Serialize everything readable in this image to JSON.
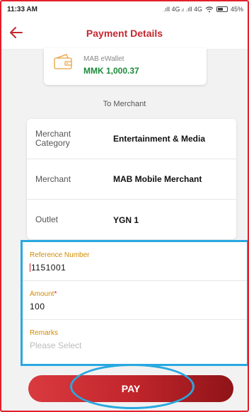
{
  "status_bar": {
    "time": "11:33 AM",
    "network": ".ıll 4G ᵢₗ .ıll 4G",
    "battery": "45%"
  },
  "header": {
    "title": "Payment Details",
    "back_icon": "arrow-left-icon"
  },
  "wallet": {
    "icon": "wallet-icon",
    "label": "MAB eWallet",
    "balance": "MMK 1,000.37"
  },
  "section_title": "To Merchant",
  "merchant_details": [
    {
      "key": "Merchant Category",
      "value": "Entertainment & Media"
    },
    {
      "key": "Merchant",
      "value": "MAB Mobile Merchant"
    },
    {
      "key": "Outlet",
      "value": "YGN 1"
    }
  ],
  "form": {
    "reference_label": "Reference Number",
    "reference_value": "1151001",
    "amount_label": "Amount",
    "amount_required_mark": "*",
    "amount_value": "100",
    "remarks_label": "Remarks",
    "remarks_placeholder": "Please Select"
  },
  "pay_button": "PAY",
  "colors": {
    "brand_red": "#c5282f",
    "label_orange": "#d18b00",
    "balance_green": "#1b8a3a",
    "highlight_blue": "#29a8e0"
  }
}
